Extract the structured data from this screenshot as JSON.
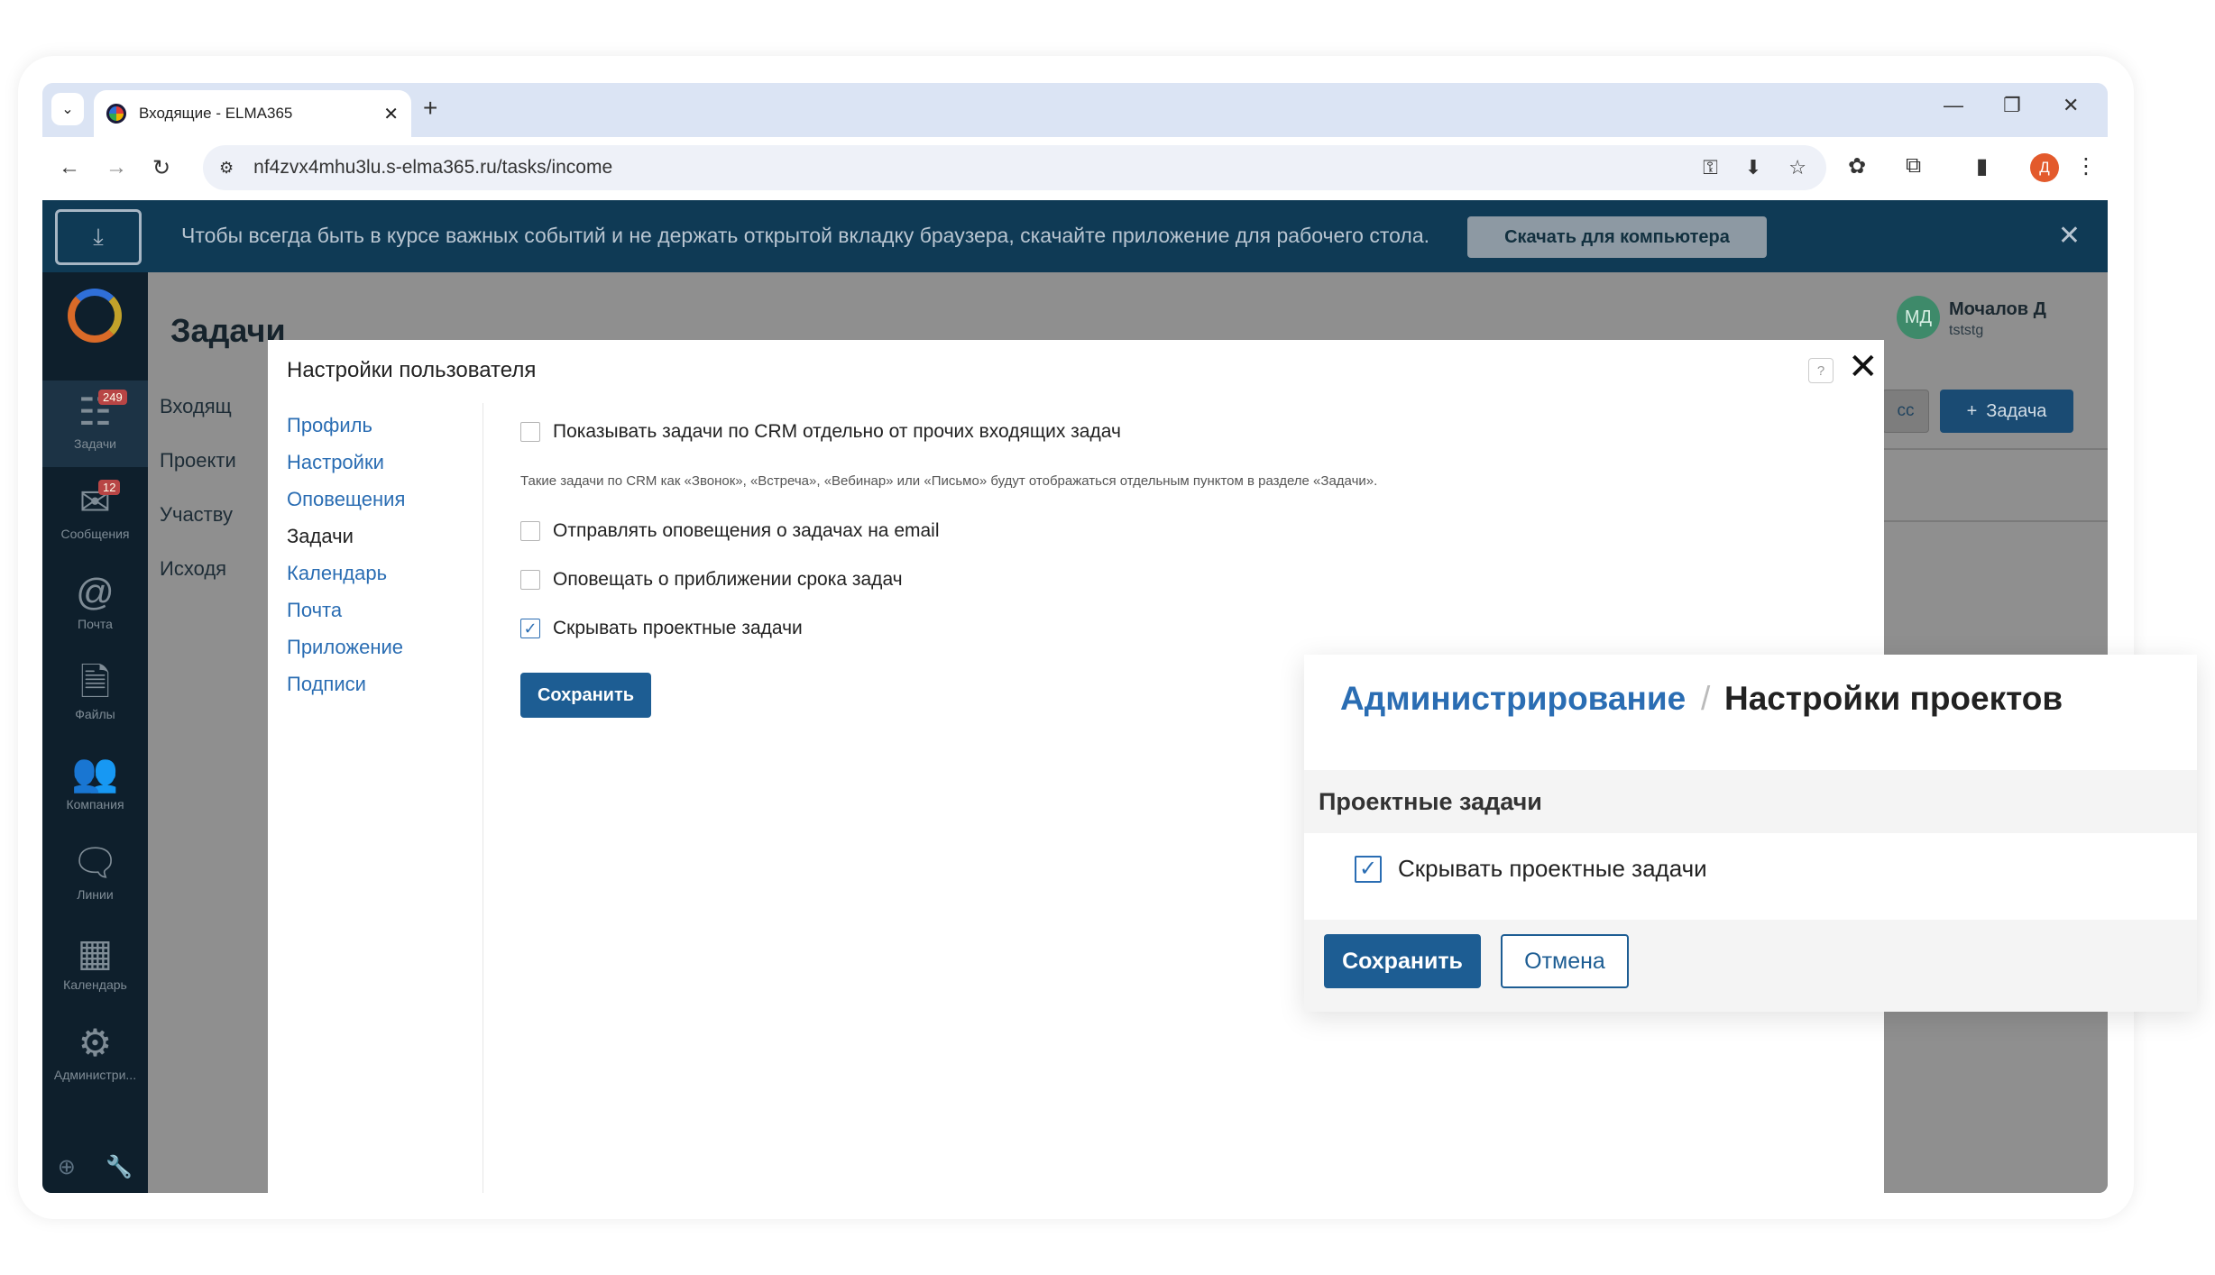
{
  "browser": {
    "tab_title": "Входящие - ELMA365",
    "url": "nf4zvx4mhu3lu.s-elma365.ru/tasks/income",
    "profile_letter": "Д"
  },
  "banner": {
    "text": "Чтобы всегда быть в курсе важных событий и не держать открытой вкладку браузера, скачайте приложение для рабочего стола.",
    "button": "Скачать для компьютера"
  },
  "sidebar": {
    "items": [
      {
        "label": "Задачи",
        "badge": "249",
        "icon": "tasks-icon",
        "glyph": "☷"
      },
      {
        "label": "Сообщения",
        "badge": "12",
        "icon": "messages-icon",
        "glyph": "✉"
      },
      {
        "label": "Почта",
        "badge": "",
        "icon": "mail-icon",
        "glyph": "@"
      },
      {
        "label": "Файлы",
        "badge": "",
        "icon": "files-icon",
        "glyph": "🗎"
      },
      {
        "label": "Компания",
        "badge": "",
        "icon": "company-icon",
        "glyph": "👥"
      },
      {
        "label": "Линии",
        "badge": "",
        "icon": "lines-icon",
        "glyph": "🗨"
      },
      {
        "label": "Календарь",
        "badge": "",
        "icon": "calendar-icon",
        "glyph": "▦"
      },
      {
        "label": "Администри...",
        "badge": "",
        "icon": "admin-gear-icon",
        "glyph": "⚙"
      }
    ]
  },
  "background": {
    "page_title": "Задачи",
    "subnav": [
      "Входящ",
      "Проекти",
      "Участву",
      "Исходя"
    ],
    "user_name": "Мочалов Д",
    "user_login": "tststg",
    "avatar_initials": "МД",
    "task_button": "Задача",
    "partial_button": "сс"
  },
  "modal": {
    "title": "Настройки пользователя",
    "help": "?",
    "nav": [
      "Профиль",
      "Настройки",
      "Оповещения",
      "Задачи",
      "Календарь",
      "Почта",
      "Приложение",
      "Подписи"
    ],
    "current_nav": "Задачи",
    "options": [
      {
        "label": "Показывать задачи по CRM отдельно от прочих входящих задач",
        "checked": false
      },
      {
        "label": "Отправлять оповещения о задачах на email",
        "checked": false
      },
      {
        "label": "Оповещать о приближении срока задач",
        "checked": false
      },
      {
        "label": "Скрывать проектные задачи",
        "checked": true
      }
    ],
    "hint": "Такие задачи по CRM как «Звонок», «Встреча», «Вебинар» или «Письмо» будут отображаться отдельным пунктом в разделе «Задачи».",
    "save_label": "Сохранить"
  },
  "callout": {
    "crumb_link": "Администрирование",
    "crumb_separator": "/",
    "crumb_current": "Настройки проектов",
    "section_title": "Проектные задачи",
    "option_label": "Скрывать проектные задачи",
    "option_checked": true,
    "save_label": "Сохранить",
    "cancel_label": "Отмена"
  },
  "colors": {
    "accent": "#2a6db3",
    "primary_button": "#1d5d93",
    "banner_bg": "#0f3a55",
    "sidebar_bg": "#0e1f2c"
  }
}
